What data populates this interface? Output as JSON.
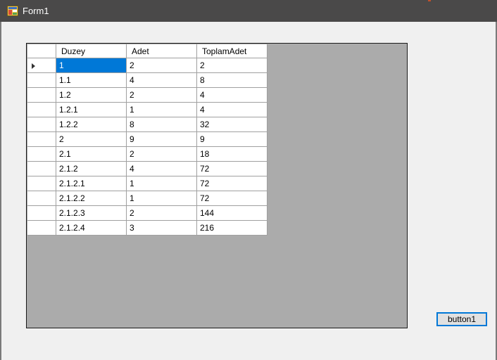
{
  "window": {
    "title": "Form1"
  },
  "grid": {
    "columns": [
      "Duzey",
      "Adet",
      "ToplamAdet"
    ],
    "rows": [
      [
        "1",
        "2",
        "2"
      ],
      [
        "1.1",
        "4",
        "8"
      ],
      [
        "1.2",
        "2",
        "4"
      ],
      [
        "1.2.1",
        "1",
        "4"
      ],
      [
        "1.2.2",
        "8",
        "32"
      ],
      [
        "2",
        "9",
        "9"
      ],
      [
        "2.1",
        "2",
        "18"
      ],
      [
        "2.1.2",
        "4",
        "72"
      ],
      [
        "2.1.2.1",
        "1",
        "72"
      ],
      [
        "2.1.2.2",
        "1",
        "72"
      ],
      [
        "2.1.2.3",
        "2",
        "144"
      ],
      [
        "2.1.2.4",
        "3",
        "216"
      ]
    ],
    "selected_row": 0,
    "selected_col": 0
  },
  "button1": {
    "label": "button1"
  },
  "colors": {
    "titlebar": "#4a4949",
    "selection": "#0078d7",
    "grid_background": "#ababab",
    "form_background": "#f0f0f0"
  },
  "icons": {
    "title": "form-window-icon",
    "row_indicator": "current-row-arrow-icon"
  }
}
